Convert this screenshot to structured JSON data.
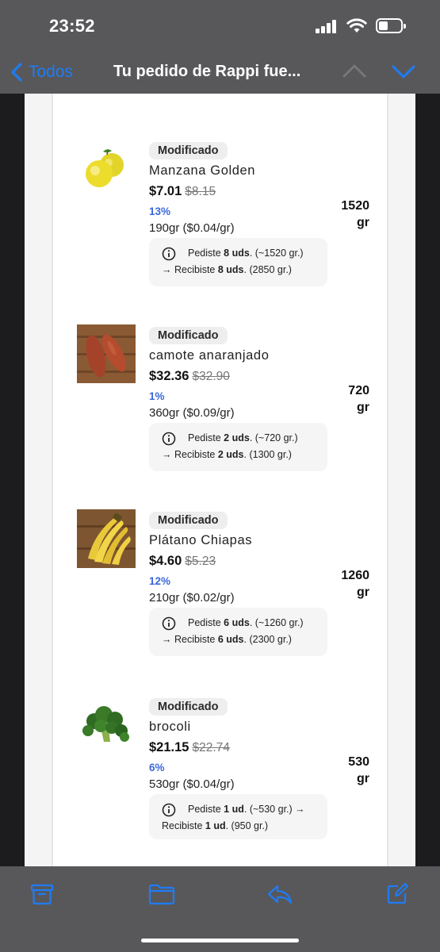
{
  "status_bar": {
    "time": "23:52"
  },
  "nav": {
    "back_label": "Todos",
    "title": "Tu pedido de Rappi fue..."
  },
  "products": [
    {
      "badge": "Modificado",
      "name": "Manzana Golden",
      "price": "$7.01",
      "old_price": "$8.15",
      "discount": "13%",
      "weight": "190gr ($0.04/gr)",
      "qty_value": "1520",
      "qty_unit": "gr",
      "info": {
        "pre": "Pediste ",
        "ordered": "8 uds",
        "mid": ". (~1520 gr.)",
        "arrow": "→ Recibiste ",
        "received": "8 uds",
        "post": ". (2850 gr.)"
      },
      "image_icon": "apple-image"
    },
    {
      "badge": "Modificado",
      "name": "camote anaranjado",
      "price": "$32.36",
      "old_price": "$32.90",
      "discount": "1%",
      "weight": "360gr ($0.09/gr)",
      "qty_value": "720",
      "qty_unit": "gr",
      "info": {
        "pre": "Pediste ",
        "ordered": "2 uds",
        "mid": ". (~720 gr.)",
        "arrow": "→ Recibiste ",
        "received": "2 uds",
        "post": ". (1300 gr.)"
      },
      "image_icon": "sweet-potato-image"
    },
    {
      "badge": "Modificado",
      "name": "Plátano Chiapas",
      "price": "$4.60",
      "old_price": "$5.23",
      "discount": "12%",
      "weight": "210gr ($0.02/gr)",
      "qty_value": "1260",
      "qty_unit": "gr",
      "info": {
        "pre": "Pediste ",
        "ordered": "6 uds",
        "mid": ". (~1260 gr.)",
        "arrow": "→ Recibiste ",
        "received": "6 uds",
        "post": ". (2300 gr.)"
      },
      "image_icon": "banana-image"
    },
    {
      "badge": "Modificado",
      "name": "brocoli",
      "price": "$21.15",
      "old_price": "$22.74",
      "discount": "6%",
      "weight": "530gr ($0.04/gr)",
      "qty_value": "530",
      "qty_unit": "gr",
      "info": {
        "pre": "Pediste ",
        "ordered": "1 ud",
        "mid": ". (~530 gr.) →",
        "arrow": "Recibiste ",
        "received": "1 ud",
        "post": ". (950 gr.)"
      },
      "image_icon": "broccoli-image"
    }
  ],
  "toolbar": {
    "icons": [
      "archive-icon",
      "folder-icon",
      "reply-icon",
      "compose-icon"
    ]
  },
  "colors": {
    "accent": "#1e7cf5",
    "discount": "#3b69d8",
    "chrome": "#58585b"
  }
}
